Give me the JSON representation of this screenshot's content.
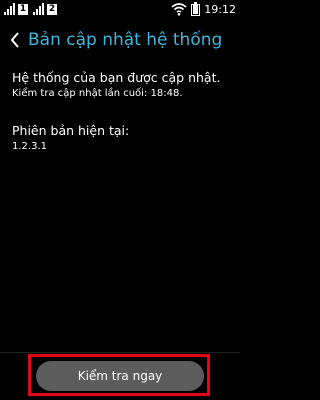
{
  "status_bar": {
    "sim1": "1",
    "sim2": "2",
    "time": "19:12",
    "icons": [
      "signal-icon",
      "signal-icon",
      "wifi-icon",
      "battery-icon"
    ]
  },
  "header": {
    "back_icon": "chevron-left-icon",
    "title": "Bản cập nhật hệ thống"
  },
  "content": {
    "status_message": "Hệ thống của bạn được cập nhật.",
    "last_check": "Kiểm tra cập nhật lần cuối: 18:48.",
    "version_label": "Phiên bản hiện tại:",
    "version_value": "1.2.3.1"
  },
  "footer": {
    "check_now_label": "Kiểm tra ngay"
  },
  "colors": {
    "accent": "#3cb6dc",
    "background": "#000000",
    "button": "#5c5c5c",
    "highlight": "#e30613"
  }
}
